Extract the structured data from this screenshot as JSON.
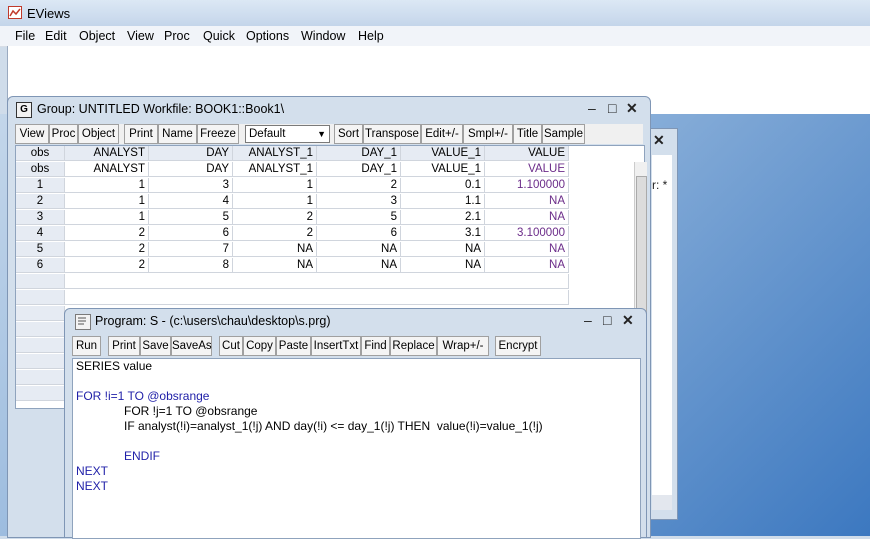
{
  "app": {
    "title": "EViews"
  },
  "menu": [
    "File",
    "Edit",
    "Object",
    "View",
    "Proc",
    "Quick",
    "Options",
    "Window",
    "Help"
  ],
  "group_window": {
    "badge": "G",
    "title": "Group: UNTITLED   Workfile: BOOK1::Book1\\",
    "toolbar": [
      "View",
      "Proc",
      "Object",
      "Print",
      "Name",
      "Freeze",
      "Sort",
      "Transpose",
      "Edit+/-",
      "Smpl+/-",
      "Title",
      "Sample"
    ],
    "sample_select": "Default",
    "columns": [
      "obs",
      "ANALYST",
      "DAY",
      "ANALYST_1",
      "DAY_1",
      "VALUE_1",
      "VALUE"
    ],
    "label_row": [
      "obs",
      "ANALYST",
      "DAY",
      "ANALYST_1",
      "DAY_1",
      "VALUE_1",
      "VALUE"
    ],
    "rows": [
      [
        "1",
        "1",
        "3",
        "1",
        "2",
        "0.1",
        "1.100000"
      ],
      [
        "2",
        "1",
        "4",
        "1",
        "3",
        "1.1",
        "NA"
      ],
      [
        "3",
        "1",
        "5",
        "2",
        "5",
        "2.1",
        "NA"
      ],
      [
        "4",
        "2",
        "6",
        "2",
        "6",
        "3.1",
        "3.100000"
      ],
      [
        "5",
        "2",
        "7",
        "NA",
        "NA",
        "NA",
        "NA"
      ],
      [
        "6",
        "2",
        "8",
        "NA",
        "NA",
        "NA",
        "NA"
      ]
    ]
  },
  "background_window": {
    "fragment": "r: *"
  },
  "program_window": {
    "title": "Program: S - (c:\\users\\chau\\desktop\\s.prg)",
    "toolbar": [
      "Run",
      "Print",
      "Save",
      "SaveAs",
      "Cut",
      "Copy",
      "Paste",
      "InsertTxt",
      "Find",
      "Replace",
      "Wrap+/-",
      "Encrypt"
    ],
    "code": {
      "l1": "SERIES value",
      "l2": "FOR !i=1 TO @obsrange",
      "l3": "FOR !j=1 TO @obsrange",
      "l4": "IF analyst(!i)=analyst_1(!j) AND day(!i) <= day_1(!j) THEN  value(!i)=value_1(!j)",
      "l5": "ENDIF",
      "l6": "NEXT",
      "l7": "NEXT"
    }
  },
  "colors": {
    "keyword": "#1f1fa8",
    "label_row": "#6b2c89"
  }
}
